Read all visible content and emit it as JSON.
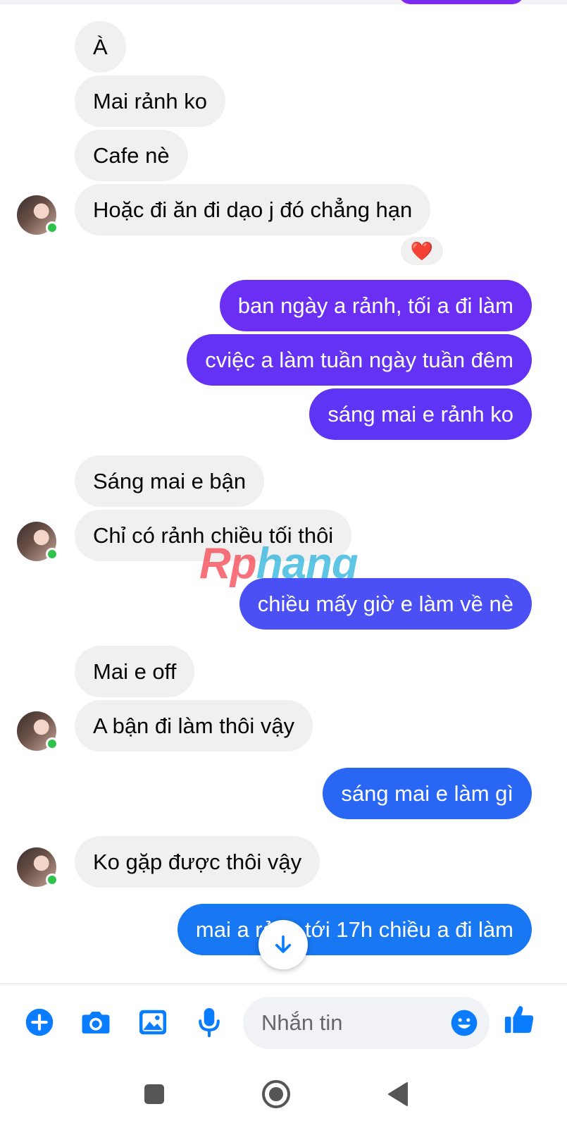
{
  "conversation": {
    "messages": [
      {
        "from": "them",
        "text": "À"
      },
      {
        "from": "them",
        "text": "Mai rảnh ko"
      },
      {
        "from": "them",
        "text": "Cafe nè"
      },
      {
        "from": "them",
        "text": "Hoặc đi ăn đi dạo j đó chẳng hạn",
        "reaction": "❤️"
      },
      {
        "from": "me",
        "text": "ban ngày a rảnh, tối a đi làm"
      },
      {
        "from": "me",
        "text": "cviệc a làm tuần ngày tuần đêm"
      },
      {
        "from": "me",
        "text": "sáng mai e rảnh ko"
      },
      {
        "from": "them",
        "text": "Sáng mai e bận"
      },
      {
        "from": "them",
        "text": "Chỉ có rảnh chiều tối thôi"
      },
      {
        "from": "me",
        "text": "chiều mấy giờ e làm về nè"
      },
      {
        "from": "them",
        "text": "Mai e off"
      },
      {
        "from": "them",
        "text": "A bận đi làm thôi vậy"
      },
      {
        "from": "me",
        "text": "sáng mai e làm gì"
      },
      {
        "from": "them",
        "text": "Ko gặp được thôi vậy"
      },
      {
        "from": "me",
        "text": "mai a rảnh tới 17h chiều a đi làm"
      }
    ]
  },
  "watermark": {
    "part1": "Rp",
    "part2": "hang"
  },
  "composer": {
    "placeholder": "Nhắn tin",
    "icons": [
      "plus-icon",
      "camera-icon",
      "gallery-icon",
      "microphone-icon",
      "emoji-icon",
      "thumbs-up-icon"
    ]
  },
  "colors": {
    "incoming_bubble": "#f0f0f0",
    "outgoing_purple": "#7b2cf0",
    "outgoing_violet": "#5b3ef5",
    "outgoing_blue": "#1877f2",
    "icon_blue": "#0a7cff",
    "online": "#31c24d"
  }
}
